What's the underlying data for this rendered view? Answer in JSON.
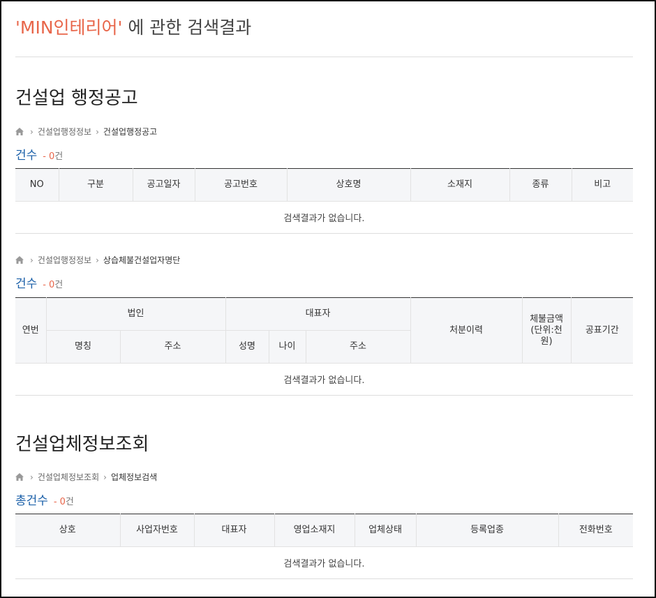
{
  "search": {
    "keyword": "'MIN인테리어'",
    "suffix": "에 관한 검색결과"
  },
  "sections": {
    "admin": {
      "title": "건설업 행정공고",
      "notice": {
        "breadcrumb": [
          "건설업행정정보",
          "건설업행정공고"
        ],
        "count_label": "건수",
        "count_dash": "-",
        "count_value": "0",
        "count_unit": "건",
        "columns": [
          "NO",
          "구분",
          "공고일자",
          "공고번호",
          "상호명",
          "소재지",
          "종류",
          "비고"
        ],
        "empty_message": "검색결과가 없습니다."
      },
      "unpaid": {
        "breadcrumb": [
          "건설업행정정보",
          "상습체불건설업자명단"
        ],
        "count_label": "건수",
        "count_dash": "-",
        "count_value": "0",
        "count_unit": "건",
        "columns": {
          "seq": "연번",
          "corp": "법인",
          "corp_name": "명칭",
          "corp_addr": "주소",
          "rep": "대표자",
          "rep_name": "성명",
          "rep_age": "나이",
          "rep_addr": "주소",
          "history": "처분이력",
          "amount": "체불금액(단위:천원)",
          "period": "공표기간"
        },
        "empty_message": "검색결과가 없습니다."
      }
    },
    "company": {
      "title": "건설업체정보조회",
      "breadcrumb": [
        "건설업체정보조회",
        "업체정보검색"
      ],
      "count_label": "총건수",
      "count_dash": "-",
      "count_value": "0",
      "count_unit": "건",
      "columns": [
        "상호",
        "사업자번호",
        "대표자",
        "영업소재지",
        "업체상태",
        "등록업종",
        "전화번호"
      ],
      "empty_message": "검색결과가 없습니다."
    }
  },
  "icons": {
    "home": "home-icon",
    "breadcrumb_separator": "chevron-right-icon"
  },
  "colors": {
    "keyword": "#e8664a",
    "count_label": "#1a5fa8",
    "count_value": "#e8664a"
  }
}
